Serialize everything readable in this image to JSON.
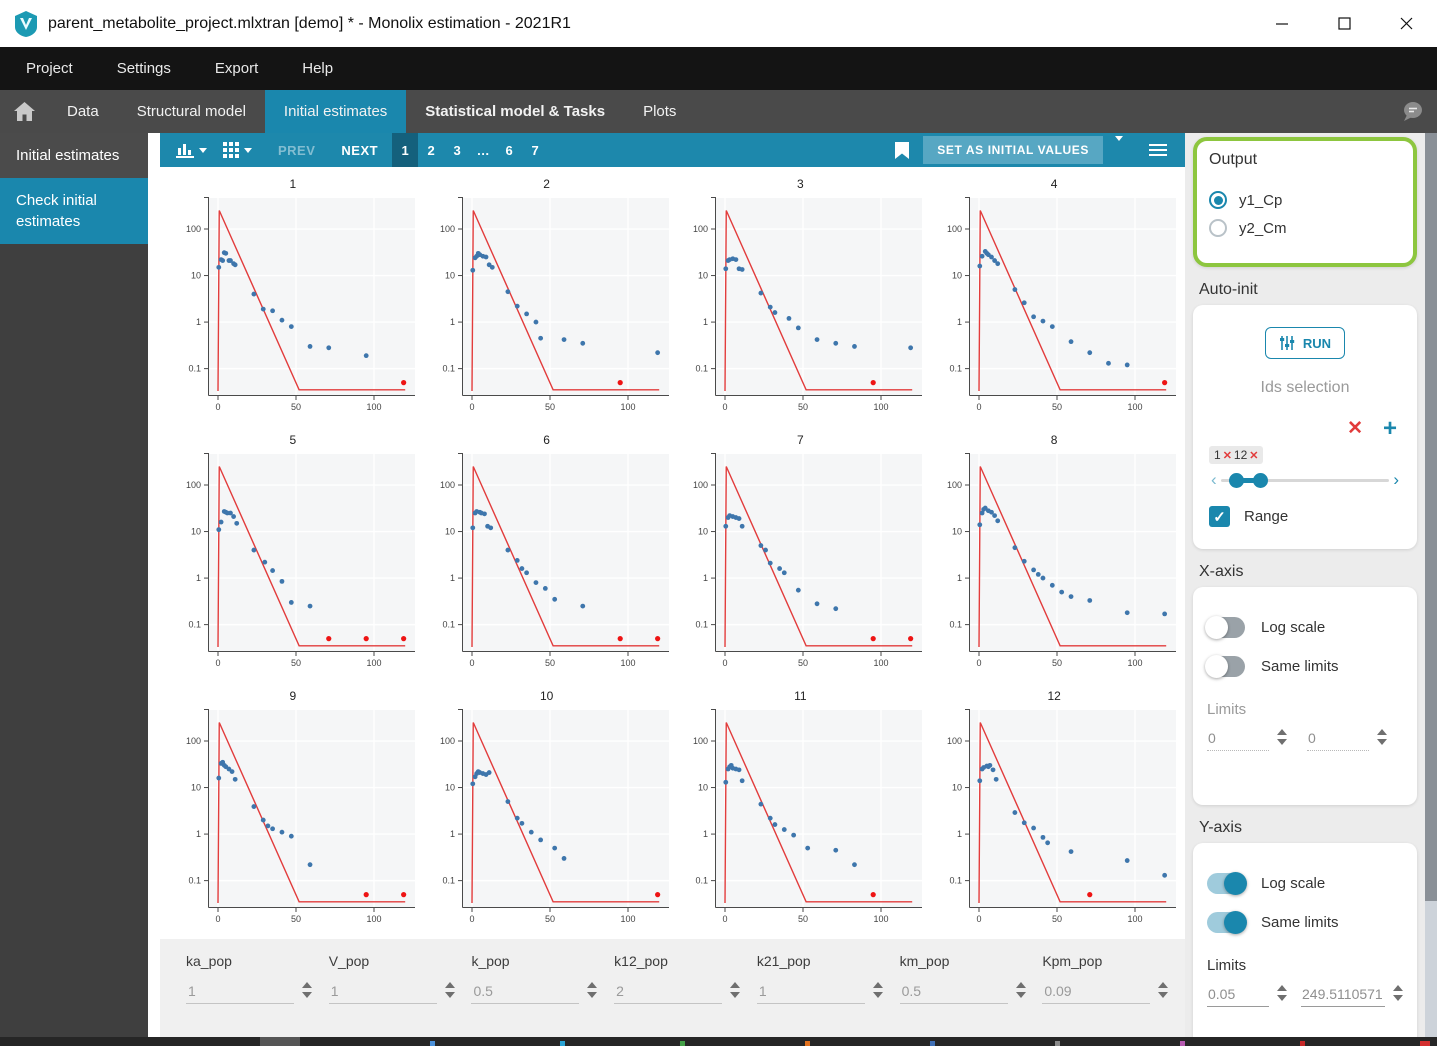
{
  "window": {
    "title": "parent_metabolite_project.mlxtran [demo] * - Monolix estimation - 2021R1",
    "controls": [
      "minimize-icon",
      "maximize-icon",
      "close-icon"
    ]
  },
  "menu_bar": {
    "items": [
      "Project",
      "Settings",
      "Export",
      "Help"
    ]
  },
  "tab_bar": {
    "home_icon": "home-icon",
    "tabs": [
      {
        "label": "Data",
        "active": false,
        "bold": false
      },
      {
        "label": "Structural model",
        "active": false,
        "bold": false
      },
      {
        "label": "Initial estimates",
        "active": true,
        "bold": false
      },
      {
        "label": "Statistical model & Tasks",
        "active": false,
        "bold": true
      },
      {
        "label": "Plots",
        "active": false,
        "bold": false
      }
    ],
    "chat_icon": "chat-bubble-icon"
  },
  "sidebar": {
    "items": [
      {
        "label": "Initial estimates",
        "active": false
      },
      {
        "label": "Check initial estimates",
        "active": true
      }
    ]
  },
  "toolbar": {
    "chart_type_icon": "bar-chart-icon",
    "grid_layout_icon": "grid-icon",
    "prev_label": "PREV",
    "next_label": "NEXT",
    "pages": [
      "1",
      "2",
      "3",
      "…",
      "6",
      "7"
    ],
    "active_page": "1",
    "bookmark_icon": "bookmark-icon",
    "set_button_label": "SET AS INITIAL VALUES",
    "menu_icon": "hamburger-icon"
  },
  "chart_data": {
    "type": "scatter",
    "note": "12 individual-fit subplots; blue observed points, red model prediction line, red censored points at y=0.05",
    "x_ticks": [
      0,
      50,
      100
    ],
    "y_ticks": [
      100,
      10,
      1,
      0.1
    ],
    "y_log": true,
    "red_line": [
      [
        0,
        0.033
      ],
      [
        0.8,
        250
      ],
      [
        52,
        0.035
      ],
      [
        120,
        0.035
      ]
    ],
    "subplots": [
      {
        "title": "1",
        "points": [
          [
            0.5,
            15
          ],
          [
            2,
            22
          ],
          [
            3,
            21
          ],
          [
            4,
            31
          ],
          [
            5,
            30
          ],
          [
            7,
            21
          ],
          [
            8,
            21
          ],
          [
            10,
            18
          ],
          [
            11,
            17
          ],
          [
            23,
            4
          ],
          [
            29,
            1.9
          ],
          [
            35,
            1.75
          ],
          [
            41,
            1.1
          ],
          [
            47,
            0.8
          ],
          [
            59,
            0.3
          ],
          [
            71,
            0.28
          ],
          [
            95,
            0.19
          ]
        ],
        "red_points": [
          119
        ]
      },
      {
        "title": "2",
        "points": [
          [
            0.5,
            13
          ],
          [
            2,
            24
          ],
          [
            3,
            26
          ],
          [
            4,
            30
          ],
          [
            5,
            28
          ],
          [
            7,
            26
          ],
          [
            9,
            25
          ],
          [
            11,
            17
          ],
          [
            13,
            15
          ],
          [
            23,
            4.5
          ],
          [
            29,
            2.2
          ],
          [
            35,
            1.5
          ],
          [
            41,
            1.0
          ],
          [
            44,
            0.45
          ],
          [
            59,
            0.42
          ],
          [
            71,
            0.35
          ],
          [
            119,
            0.22
          ]
        ],
        "red_points": [
          95
        ]
      },
      {
        "title": "3",
        "points": [
          [
            0.5,
            14
          ],
          [
            2,
            21
          ],
          [
            3,
            22
          ],
          [
            5,
            23
          ],
          [
            7,
            22
          ],
          [
            9,
            14
          ],
          [
            11,
            13.5
          ],
          [
            23,
            4.2
          ],
          [
            29,
            2.1
          ],
          [
            32,
            1.6
          ],
          [
            41,
            1.2
          ],
          [
            47,
            0.75
          ],
          [
            59,
            0.42
          ],
          [
            71,
            0.35
          ],
          [
            83,
            0.3
          ],
          [
            119,
            0.28
          ]
        ],
        "red_points": [
          95
        ]
      },
      {
        "title": "4",
        "points": [
          [
            0.5,
            16
          ],
          [
            2,
            26
          ],
          [
            4,
            33
          ],
          [
            5,
            30
          ],
          [
            6,
            28
          ],
          [
            8,
            25
          ],
          [
            10,
            21
          ],
          [
            12,
            18
          ],
          [
            23,
            5
          ],
          [
            29,
            2.6
          ],
          [
            35,
            1.3
          ],
          [
            41,
            1.05
          ],
          [
            47,
            0.8
          ],
          [
            59,
            0.38
          ],
          [
            71,
            0.22
          ],
          [
            83,
            0.13
          ],
          [
            95,
            0.12
          ]
        ],
        "red_points": [
          119
        ]
      },
      {
        "title": "5",
        "points": [
          [
            0.5,
            11
          ],
          [
            2,
            16
          ],
          [
            4,
            27
          ],
          [
            5,
            26
          ],
          [
            6,
            25
          ],
          [
            8,
            25
          ],
          [
            10,
            21
          ],
          [
            12,
            15
          ],
          [
            23,
            4
          ],
          [
            30,
            2.2
          ],
          [
            35,
            1.45
          ],
          [
            41,
            0.85
          ],
          [
            47,
            0.3
          ],
          [
            59,
            0.25
          ]
        ],
        "red_points": [
          71,
          95,
          119
        ]
      },
      {
        "title": "6",
        "points": [
          [
            0.5,
            12
          ],
          [
            2,
            25
          ],
          [
            3,
            27
          ],
          [
            5,
            26
          ],
          [
            6,
            25
          ],
          [
            8,
            24
          ],
          [
            10,
            13
          ],
          [
            12,
            12
          ],
          [
            23,
            4
          ],
          [
            29,
            2.4
          ],
          [
            32,
            1.6
          ],
          [
            35,
            1.3
          ],
          [
            41,
            0.8
          ],
          [
            47,
            0.6
          ],
          [
            53,
            0.35
          ],
          [
            71,
            0.25
          ]
        ],
        "red_points": [
          95,
          119
        ]
      },
      {
        "title": "7",
        "points": [
          [
            0.5,
            13
          ],
          [
            2,
            20
          ],
          [
            3,
            22
          ],
          [
            5,
            21
          ],
          [
            7,
            20
          ],
          [
            9,
            19
          ],
          [
            11,
            13
          ],
          [
            23,
            5
          ],
          [
            26,
            4
          ],
          [
            29,
            2.1
          ],
          [
            35,
            1.6
          ],
          [
            38,
            1.3
          ],
          [
            47,
            0.55
          ],
          [
            59,
            0.28
          ],
          [
            71,
            0.22
          ]
        ],
        "red_points": [
          95,
          119
        ]
      },
      {
        "title": "8",
        "points": [
          [
            0.5,
            14
          ],
          [
            2,
            25
          ],
          [
            3,
            30
          ],
          [
            4,
            32
          ],
          [
            6,
            28
          ],
          [
            8,
            26
          ],
          [
            10,
            22
          ],
          [
            12,
            17
          ],
          [
            23,
            4.5
          ],
          [
            29,
            2.3
          ],
          [
            35,
            1.5
          ],
          [
            38,
            1.2
          ],
          [
            41,
            1.0
          ],
          [
            47,
            0.7
          ],
          [
            53,
            0.5
          ],
          [
            59,
            0.4
          ],
          [
            71,
            0.33
          ],
          [
            95,
            0.18
          ],
          [
            119,
            0.17
          ]
        ],
        "red_points": []
      },
      {
        "title": "9",
        "points": [
          [
            0.5,
            16
          ],
          [
            2,
            33
          ],
          [
            3,
            35
          ],
          [
            4,
            30
          ],
          [
            5,
            28
          ],
          [
            7,
            25
          ],
          [
            9,
            22
          ],
          [
            11,
            15
          ],
          [
            23,
            3.9
          ],
          [
            29,
            2.0
          ],
          [
            32,
            1.5
          ],
          [
            35,
            1.3
          ],
          [
            41,
            1.1
          ],
          [
            47,
            0.9
          ],
          [
            59,
            0.22
          ]
        ],
        "red_points": [
          95,
          119
        ]
      },
      {
        "title": "10",
        "points": [
          [
            0.5,
            12
          ],
          [
            2,
            17
          ],
          [
            3,
            20
          ],
          [
            4,
            22
          ],
          [
            5,
            21
          ],
          [
            7,
            20
          ],
          [
            9,
            19
          ],
          [
            11,
            21
          ],
          [
            23,
            5
          ],
          [
            29,
            2.2
          ],
          [
            32,
            1.7
          ],
          [
            38,
            1.1
          ],
          [
            44,
            0.75
          ],
          [
            53,
            0.5
          ],
          [
            59,
            0.3
          ]
        ],
        "red_points": [
          119
        ]
      },
      {
        "title": "11",
        "points": [
          [
            0.5,
            13
          ],
          [
            2,
            25
          ],
          [
            3,
            28
          ],
          [
            4,
            30
          ],
          [
            5,
            26
          ],
          [
            7,
            25
          ],
          [
            9,
            24
          ],
          [
            11,
            14
          ],
          [
            23,
            4.4
          ],
          [
            29,
            2.2
          ],
          [
            32,
            1.6
          ],
          [
            38,
            1.25
          ],
          [
            44,
            0.95
          ],
          [
            53,
            0.5
          ],
          [
            71,
            0.45
          ],
          [
            83,
            0.22
          ]
        ],
        "red_points": [
          95
        ]
      },
      {
        "title": "12",
        "points": [
          [
            0.5,
            14
          ],
          [
            2,
            25
          ],
          [
            3,
            27
          ],
          [
            5,
            29
          ],
          [
            6,
            28
          ],
          [
            7,
            30
          ],
          [
            9,
            24
          ],
          [
            11,
            15
          ],
          [
            23,
            2.9
          ],
          [
            29,
            1.75
          ],
          [
            35,
            1.35
          ],
          [
            41,
            0.85
          ],
          [
            44,
            0.65
          ],
          [
            59,
            0.42
          ],
          [
            95,
            0.27
          ],
          [
            119,
            0.13
          ]
        ],
        "red_points": [
          71
        ]
      }
    ]
  },
  "params": [
    {
      "label": "ka_pop",
      "value": "1"
    },
    {
      "label": "V_pop",
      "value": "1"
    },
    {
      "label": "k_pop",
      "value": "0.5"
    },
    {
      "label": "k12_pop",
      "value": "2"
    },
    {
      "label": "k21_pop",
      "value": "1"
    },
    {
      "label": "km_pop",
      "value": "0.5"
    },
    {
      "label": "Kpm_pop",
      "value": "0.09"
    }
  ],
  "panel": {
    "output": {
      "title": "Output",
      "options": [
        {
          "label": "y1_Cp",
          "selected": true
        },
        {
          "label": "y2_Cm",
          "selected": false
        }
      ]
    },
    "auto_init": {
      "title": "Auto-init",
      "run_label": "RUN",
      "run_icon": "sliders-icon",
      "ids_label": "Ids selection",
      "remove_icon": "red-x-icon",
      "add_icon": "plus-icon",
      "chip": {
        "from": "1",
        "to": "12"
      },
      "slider": {
        "left_pct": 5,
        "right_pct": 19
      },
      "range_label": "Range",
      "range_checked": true
    },
    "x_axis": {
      "title": "X-axis",
      "log_scale_label": "Log scale",
      "log_scale_on": false,
      "same_limits_label": "Same limits",
      "same_limits_on": false,
      "limits_label": "Limits",
      "min": "0",
      "max": "0"
    },
    "y_axis": {
      "title": "Y-axis",
      "log_scale_label": "Log scale",
      "log_scale_on": true,
      "same_limits_label": "Same limits",
      "same_limits_on": true,
      "limits_label": "Limits",
      "min": "0.05",
      "max": "249.5110571"
    }
  },
  "colors": {
    "accent": "#1a87ad",
    "toolbar": "#1d88ac",
    "active_page": "#14607c",
    "highlight_green": "#8dc63f",
    "point_blue": "#3e76ac",
    "line_red": "#e23c3c",
    "dot_red": "#ee1414"
  }
}
